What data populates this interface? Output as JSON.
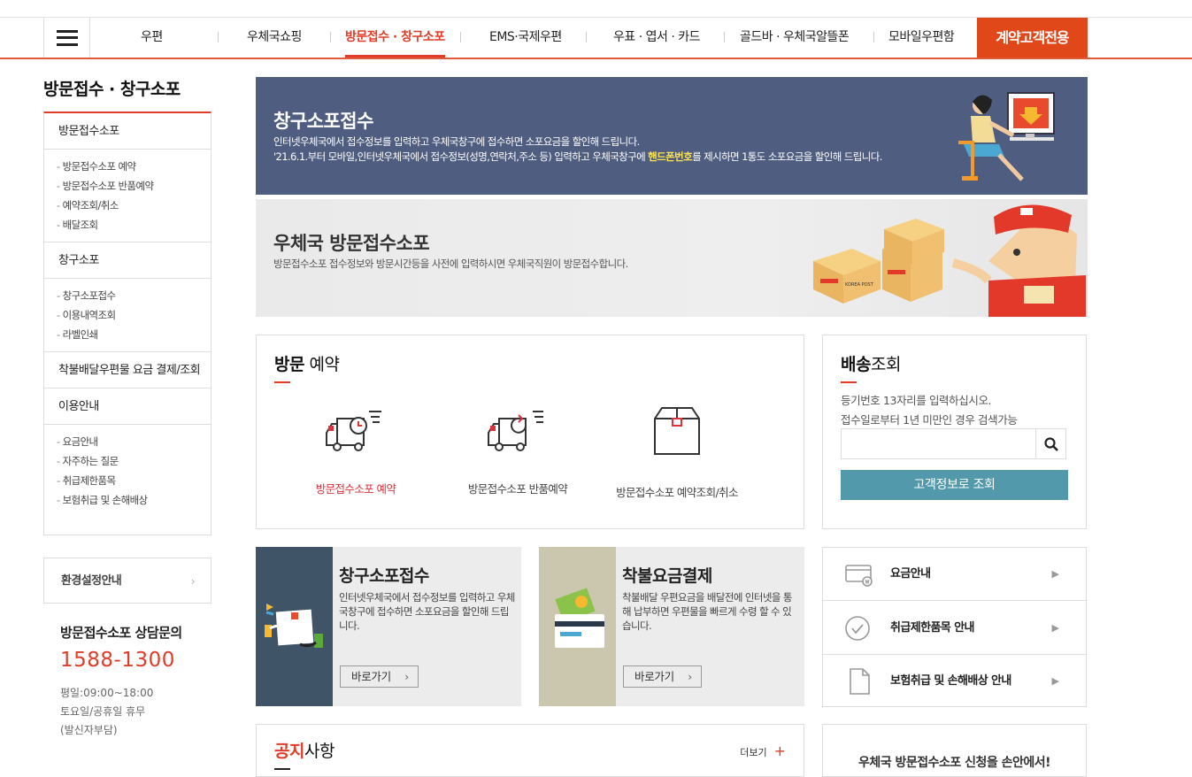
{
  "gnb": {
    "items": [
      "우편",
      "우체국쇼핑",
      "방문접수 · 창구소포",
      "EMS·국제우편",
      "우표 · 엽서 · 카드",
      "골드바 · 우체국알뜰폰",
      "모바일우편함"
    ],
    "contract_label": "계약고객전용"
  },
  "lnb": {
    "title": "방문접수 · 창구소포",
    "groups": [
      {
        "label": "방문접수소포",
        "items": [
          "방문접수소포 예약",
          "방문접수소포 반품예약",
          "예약조회/취소",
          "배달조회"
        ]
      },
      {
        "label": "창구소포",
        "items": [
          "창구소포접수",
          "이용내역조회",
          "라벨인쇄"
        ]
      },
      {
        "label": "착불배달우편물 요금 결제/조회",
        "items": []
      },
      {
        "label": "이용안내",
        "items": [
          "요금안내",
          "자주하는 질문",
          "취급제한품목",
          "보험취급 및 손해배상"
        ]
      }
    ]
  },
  "env": {
    "label": "환경설정안내",
    "chevron": "›"
  },
  "cs": {
    "title": "방문접수소포 상담문의",
    "phone": "1588-1300",
    "hours": "평일:09:00~18:00",
    "holiday": "토요일/공휴일 휴무",
    "charge": "(발신자부담)"
  },
  "banner1": {
    "title": "창구소포접수",
    "line1": "인터넷우체국에서 접수정보를 입력하고 우체국창구에 접수하면 소포요금을 할인해 드립니다.",
    "line2_pre": "'21.6.1.부터 모바일,인터넷우체국에서 접수정보(성명,연락처,주소 등) 입력하고 우체국창구에 ",
    "line2_highlight": "핸드폰번호",
    "line2_post": "를 제시하면 1통도 소포요금을 할인해 드립니다."
  },
  "banner2": {
    "title": "우체국 방문접수소포",
    "desc": "방문접수소포 접수정보와 방문시간등을 사전에 입력하시면 우체국직원이 방문접수합니다.",
    "box_label": "KOREA POST"
  },
  "visit": {
    "title_bold": "방문",
    "title_rest": " 예약",
    "options": [
      {
        "label": "방문접수소포 예약",
        "icon": "truck-clock-icon"
      },
      {
        "label": "방문접수소포 반품예약",
        "icon": "truck-return-icon"
      },
      {
        "label": "방문접수소포 예약조회/취소",
        "icon": "parcel-box-icon"
      }
    ]
  },
  "track": {
    "title_bold": "배송",
    "title_rest": "조회",
    "guide1": "등기번호 13자리를 입력하십시오.",
    "guide2": "접수일로부터 1년 미만인 경우 검색가능",
    "input_value": "",
    "button": "고객정보로 조회"
  },
  "cards": [
    {
      "title": "창구소포접수",
      "desc": "인터넷우체국에서 접수정보를 입력하고 우체국창구에 접수하면 소포요금을 할인해 드립니다.",
      "go": "바로가기"
    },
    {
      "title": "착불요금결제",
      "desc": "착불배달 우편요금을 배달전에 인터넷을 통해 납부하면 우편물을 빠르게 수령 할 수 있습니다.",
      "go": "바로가기"
    }
  ],
  "links": [
    {
      "label": "요금안내",
      "icon": "fee-card-icon"
    },
    {
      "label": "취급제한품목 안내",
      "icon": "check-circle-icon"
    },
    {
      "label": "보험취급 및 손해배상 안내",
      "icon": "document-icon"
    }
  ],
  "notice": {
    "title_red": "공지",
    "title_rest": "사항",
    "more": "더보기",
    "plus": "+"
  },
  "promo": {
    "text": "우체국 방문접수소포 신청을 손안에서!"
  },
  "colors": {
    "accent": "#e03c28",
    "contract_bg": "#e0481a",
    "banner1_bg": "#4f5d80",
    "teal_button": "#529aab"
  }
}
